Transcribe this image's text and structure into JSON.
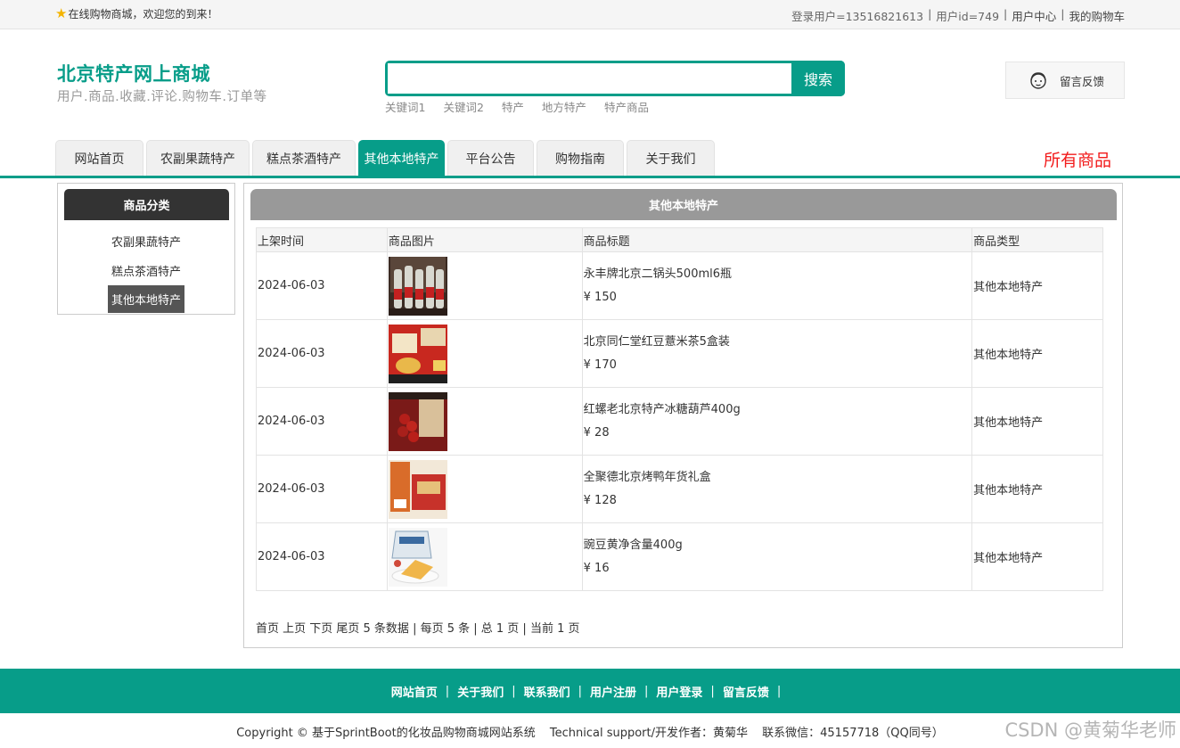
{
  "topbar": {
    "welcome": "在线购物商城，欢迎您的到来！",
    "user": "登录用户=13516821613",
    "user_id": "用户id=749",
    "user_center": "用户中心",
    "cart": "我的购物车"
  },
  "header": {
    "title": "北京特产网上商城",
    "subtitle": "用户.商品.收藏.评论.购物车.订单等",
    "search_button": "搜索",
    "search_value": "",
    "keywords": [
      "关键词1",
      "关键词2",
      "特产",
      "地方特产",
      "特产商品"
    ],
    "feedback": "留言反馈"
  },
  "nav": {
    "tabs": [
      "网站首页",
      "农副果蔬特产",
      "糕点茶酒特产",
      "其他本地特产",
      "平台公告",
      "购物指南",
      "关于我们"
    ],
    "active_index": 3,
    "all_goods": "所有商品"
  },
  "sidebar": {
    "title": "商品分类",
    "items": [
      "农副果蔬特产",
      "糕点茶酒特产",
      "其他本地特产"
    ],
    "active_index": 2
  },
  "main": {
    "title": "其他本地特产",
    "columns": [
      "上架时间",
      "商品图片",
      "商品标题",
      "商品类型"
    ],
    "rows": [
      {
        "date": "2024-06-03",
        "title": "永丰牌北京二锅头500ml6瓶",
        "price": "¥ 150",
        "type": "其他本地特产"
      },
      {
        "date": "2024-06-03",
        "title": "北京同仁堂红豆薏米茶5盒装",
        "price": "¥ 170",
        "type": "其他本地特产"
      },
      {
        "date": "2024-06-03",
        "title": "红螺老北京特产冰糖葫芦400g",
        "price": "¥ 28",
        "type": "其他本地特产"
      },
      {
        "date": "2024-06-03",
        "title": "全聚德北京烤鸭年货礼盒",
        "price": "¥ 128",
        "type": "其他本地特产"
      },
      {
        "date": "2024-06-03",
        "title": "豌豆黄净含量400g",
        "price": "¥ 16",
        "type": "其他本地特产"
      }
    ],
    "pager": "首页 上页 下页 尾页 5 条数据 | 每页 5 条 | 总 1 页 | 当前 1 页"
  },
  "footer": {
    "links": [
      "网站首页",
      "关于我们",
      "联系我们",
      "用户注册",
      "用户登录",
      "留言反馈"
    ],
    "copyright": "Copyright © 基于SprintBoot的化妆品购物商城网站系统",
    "support": "Technical support/开发作者：黄菊华",
    "contact": "联系微信：45157718（QQ同号）",
    "watermark": "CSDN @黄菊华老师"
  }
}
